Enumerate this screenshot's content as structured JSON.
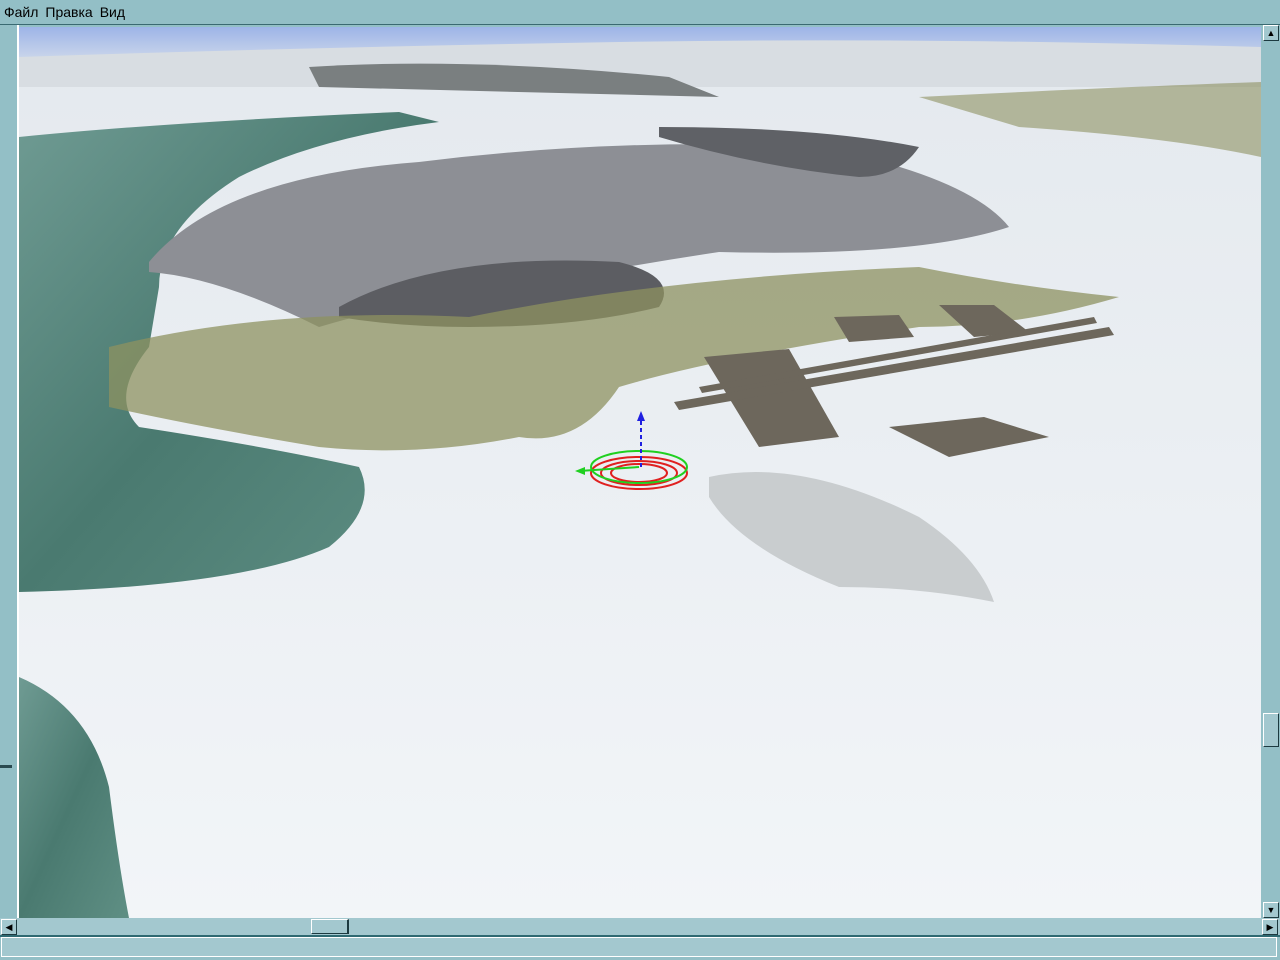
{
  "menu": {
    "items": [
      "Файл",
      "Правка",
      "Вид"
    ]
  },
  "viewport": {
    "scene": "3d-terrain",
    "sky_color": "#9db4e8",
    "snow_color": "#eef2f5",
    "water_color": "#5b8a80"
  },
  "scrollbars": {
    "up_arrow": "▲",
    "down_arrow": "▼",
    "left_arrow": "◀",
    "right_arrow": "▶"
  },
  "status": {
    "text": ""
  }
}
